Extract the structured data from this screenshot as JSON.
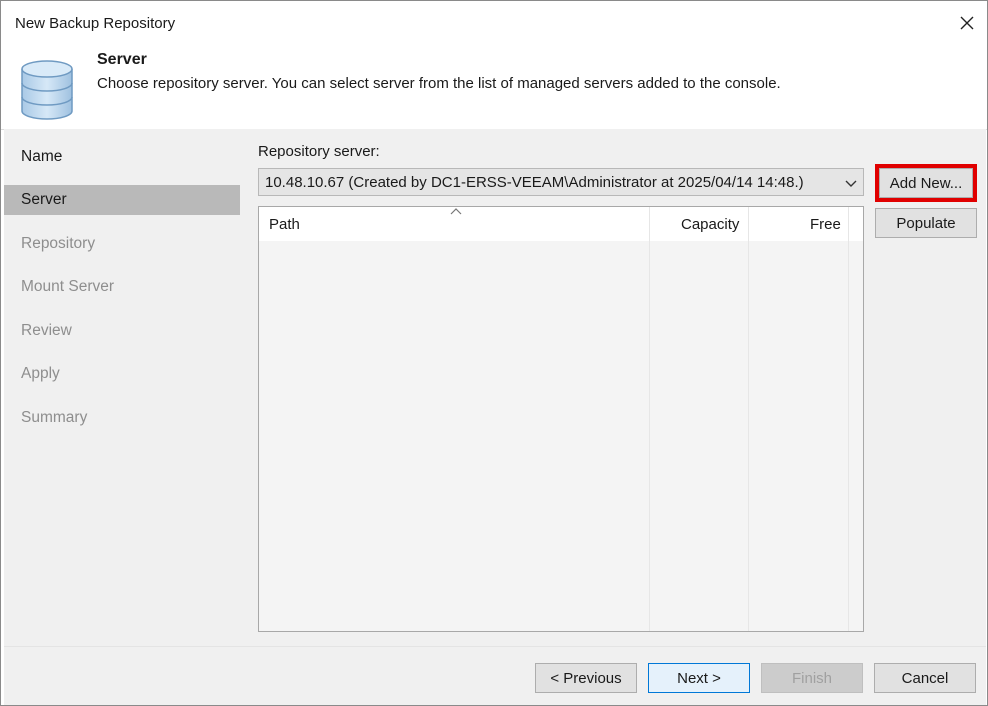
{
  "window": {
    "title": "New Backup Repository"
  },
  "header": {
    "title": "Server",
    "description": "Choose repository server. You can select server from the list of managed servers added to the console."
  },
  "nav": {
    "items": [
      {
        "label": "Name"
      },
      {
        "label": "Server"
      },
      {
        "label": "Repository"
      },
      {
        "label": "Mount Server"
      },
      {
        "label": "Review"
      },
      {
        "label": "Apply"
      },
      {
        "label": "Summary"
      }
    ]
  },
  "server": {
    "label": "Repository server:",
    "selected": "10.48.10.67 (Created by DC1-ERSS-VEEAM\\Administrator at 2025/04/14 14:48.)"
  },
  "buttons": {
    "add_new": "Add New...",
    "populate": "Populate",
    "previous": "< Previous",
    "next": "Next >",
    "finish": "Finish",
    "cancel": "Cancel"
  },
  "table": {
    "columns": [
      "Path",
      "Capacity",
      "Free"
    ],
    "rows": []
  },
  "colors": {
    "highlight": "#e00000",
    "panel": "#f0f0f0",
    "active_nav": "#b9b9b9",
    "primary_border": "#0078d7"
  }
}
